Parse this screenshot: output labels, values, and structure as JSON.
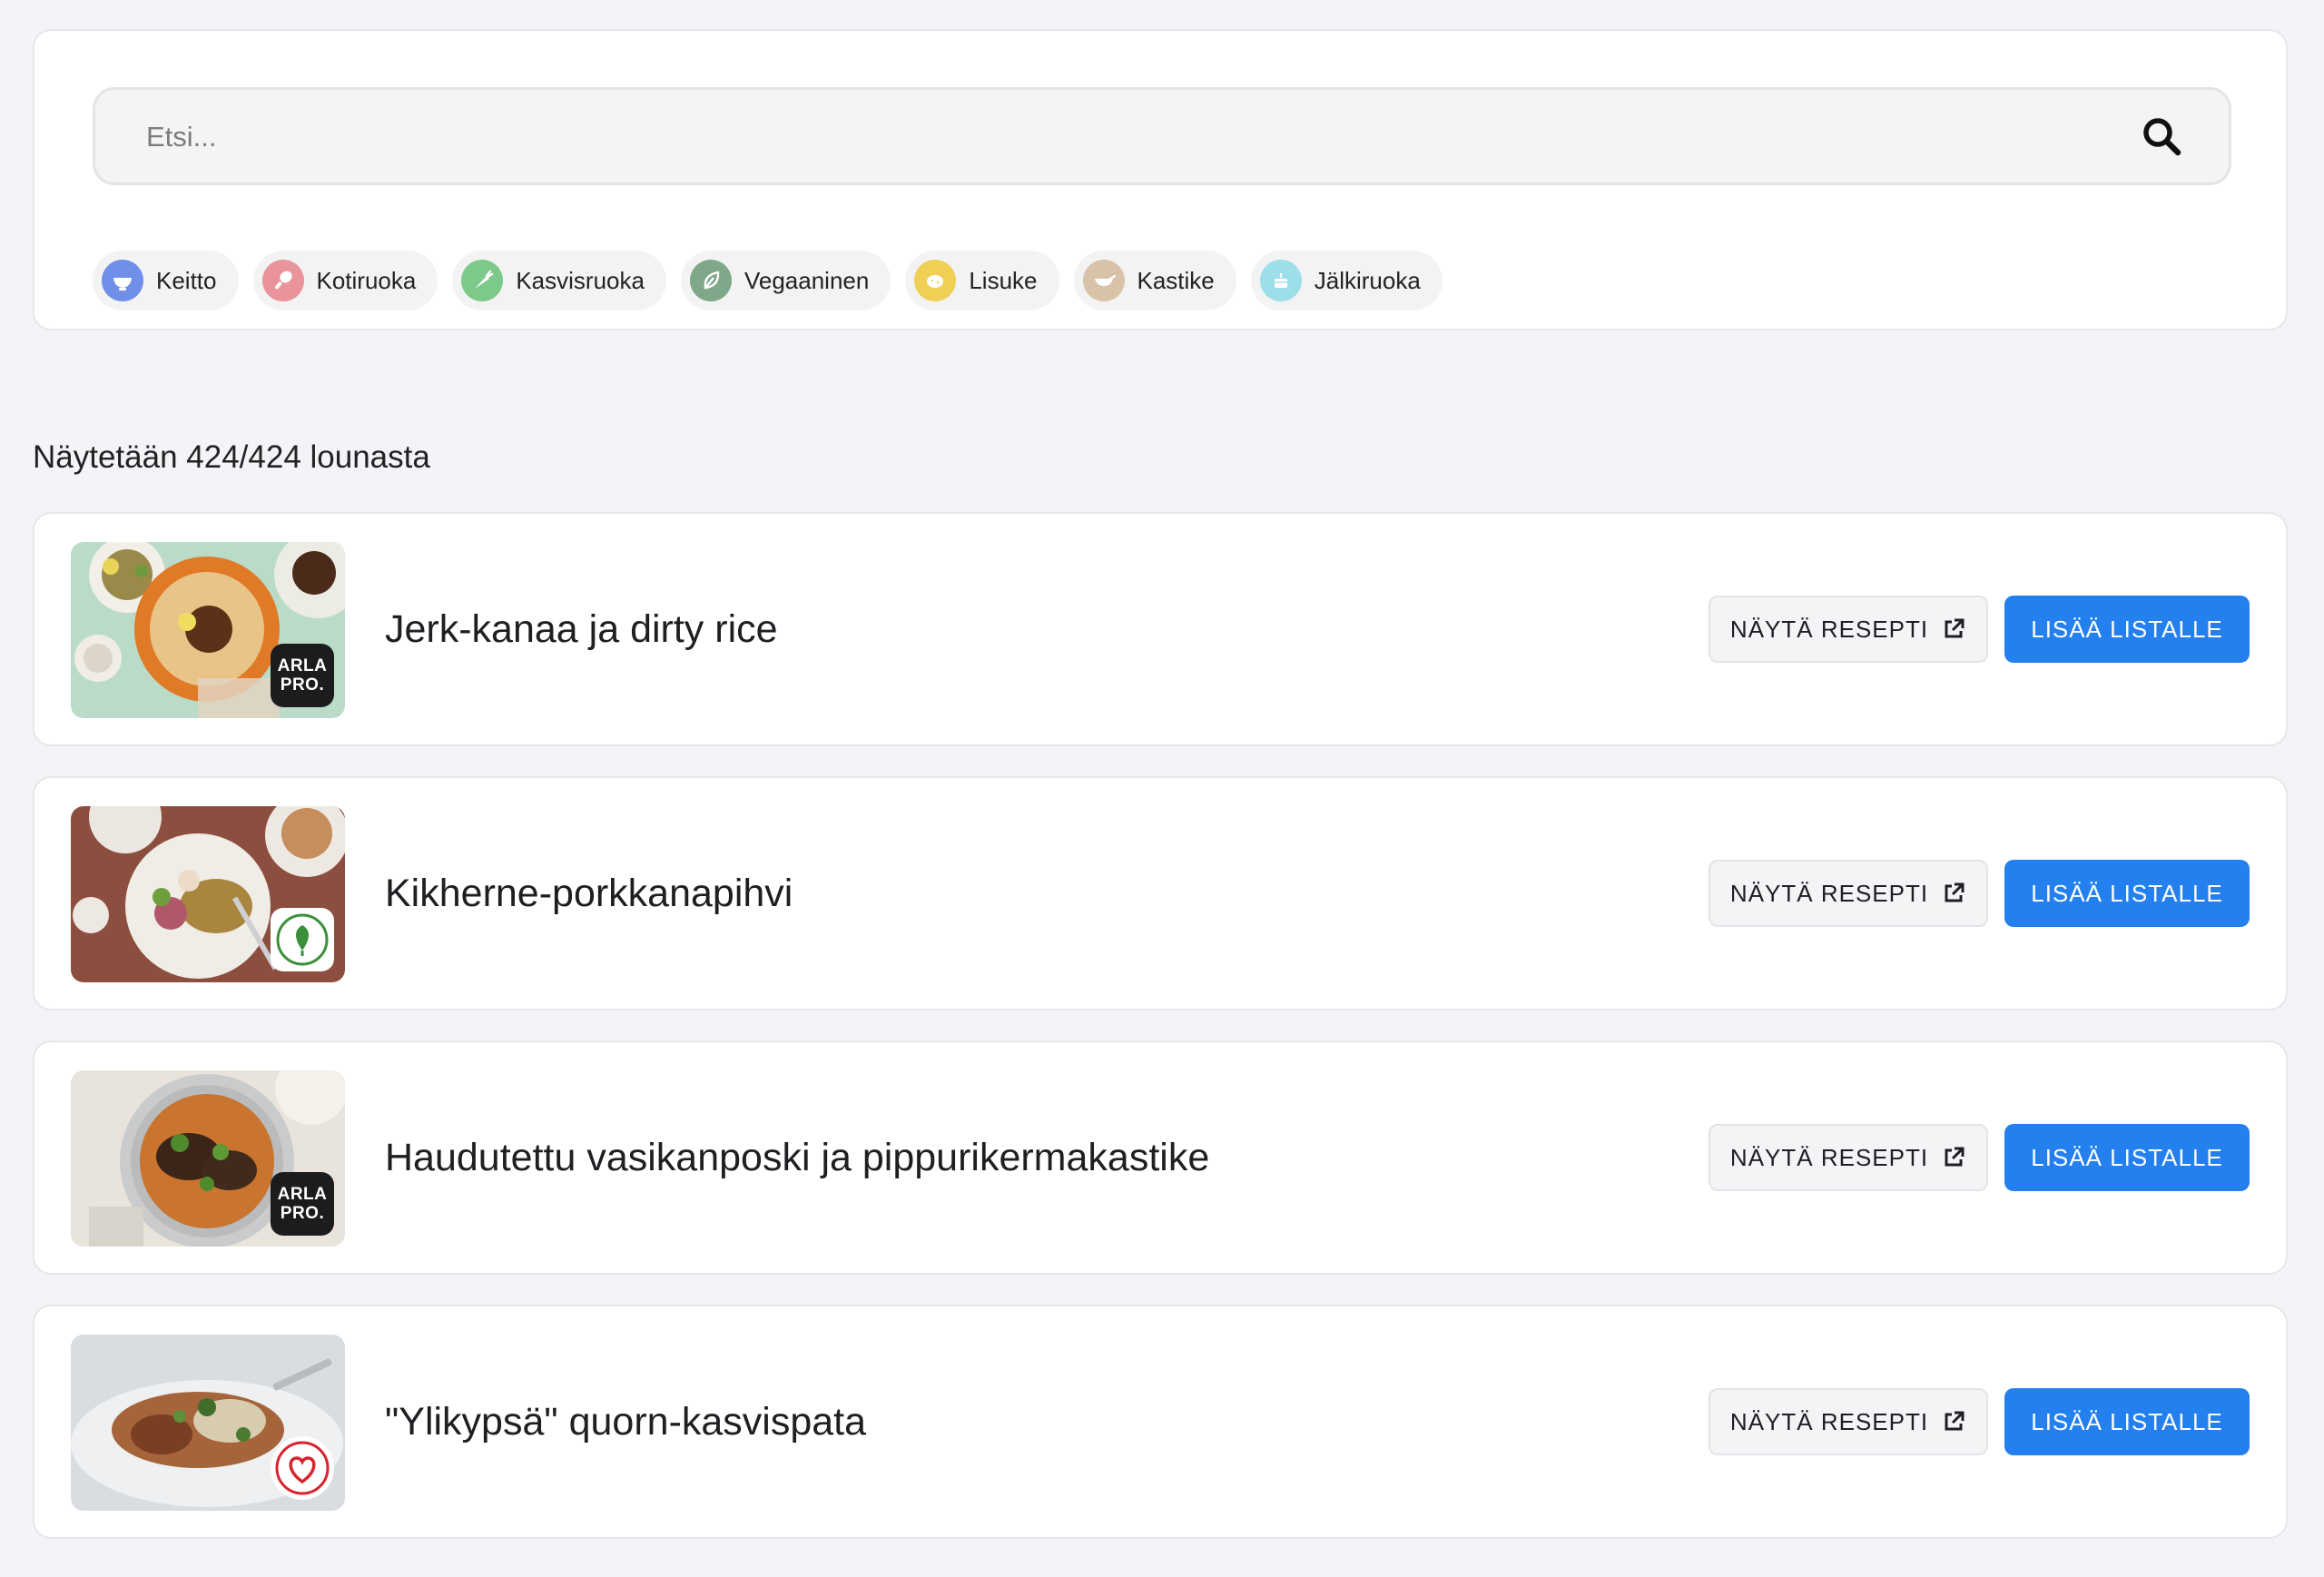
{
  "search": {
    "placeholder": "Etsi...",
    "icon": "search-icon"
  },
  "categories": [
    {
      "label": "Keitto",
      "icon": "bowl-icon",
      "color": "#6f8fe8"
    },
    {
      "label": "Kotiruoka",
      "icon": "drumstick-icon",
      "color": "#e8949a"
    },
    {
      "label": "Kasvisruoka",
      "icon": "carrot-icon",
      "color": "#7dc98a"
    },
    {
      "label": "Vegaaninen",
      "icon": "leaf-icon",
      "color": "#7fa889"
    },
    {
      "label": "Lisuke",
      "icon": "potato-icon",
      "color": "#f0cf55"
    },
    {
      "label": "Kastike",
      "icon": "gravy-boat-icon",
      "color": "#d8c2a8"
    },
    {
      "label": "Jälkiruoka",
      "icon": "cake-icon",
      "color": "#9ddfe8"
    }
  ],
  "results": {
    "count_text": "Näytetään 424/424 lounasta"
  },
  "meals": [
    {
      "title": "Jerk-kanaa ja dirty rice",
      "badge": "arla-pro",
      "badge_lines": [
        "ARLA",
        "PRO."
      ]
    },
    {
      "title": "Kikherne-porkkanapihvi",
      "badge": "kasvisruoka-leaf"
    },
    {
      "title": "Haudutettu vasikanposki ja pippurikermakastike",
      "badge": "arla-pro",
      "badge_lines": [
        "ARLA",
        "PRO."
      ]
    },
    {
      "title": "\"Ylikypsä\" quorn-kasvispata",
      "badge": "parempi-valinta-heart"
    }
  ],
  "actions": {
    "view_recipe": "NÄYTÄ RESEPTI",
    "view_recipe_icon": "external-link-icon",
    "add_to_list": "LISÄÄ LISTALLE"
  }
}
